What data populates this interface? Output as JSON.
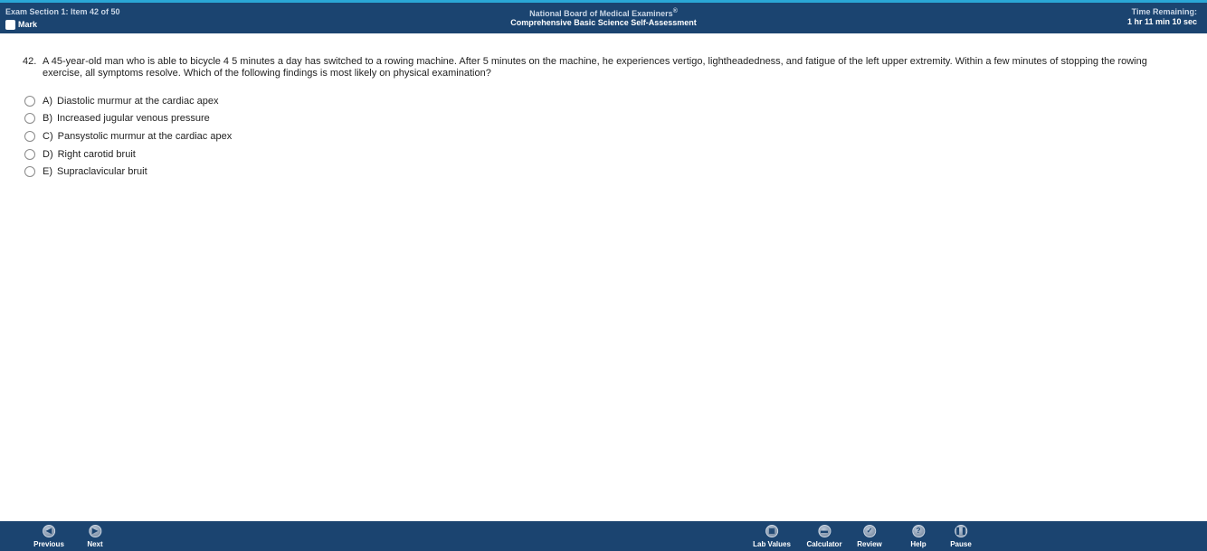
{
  "header": {
    "section_label": "Exam Section 1: Item 42 of 50",
    "mark_label": "Mark",
    "org_name": "National Board of Medical Examiners",
    "org_mark": "®",
    "assessment_name": "Comprehensive Basic Science Self-Assessment",
    "time_label": "Time Remaining:",
    "time_value": "1 hr 11 min 10 sec"
  },
  "question": {
    "number": "42.",
    "text": "A 45-year-old man who is able to bicycle 4 5 minutes a day has switched to a rowing machine. After 5 minutes on the machine, he experiences vertigo, lightheadedness, and fatigue of the left upper extremity. Within a few minutes of stopping the rowing exercise, all symptoms resolve. Which of the following findings is most likely on physical examination?"
  },
  "options": [
    {
      "letter": "A)",
      "text": "Diastolic murmur at the cardiac apex"
    },
    {
      "letter": "B)",
      "text": "Increased jugular venous pressure"
    },
    {
      "letter": "C)",
      "text": "Pansystolic murmur at the cardiac apex"
    },
    {
      "letter": "D)",
      "text": "Right carotid bruit"
    },
    {
      "letter": "E)",
      "text": "Supraclavicular bruit"
    }
  ],
  "footer": {
    "previous": {
      "label": "Previous",
      "icon": "arrow-left-icon",
      "glyph": "◀"
    },
    "next": {
      "label": "Next",
      "icon": "arrow-right-icon",
      "glyph": "▶"
    },
    "lab_values": {
      "label": "Lab Values",
      "icon": "lab-values-icon",
      "glyph": "▦"
    },
    "calculator": {
      "label": "Calculator",
      "icon": "calculator-icon",
      "glyph": "▬"
    },
    "review": {
      "label": "Review",
      "icon": "review-check-icon",
      "glyph": "✓"
    },
    "help": {
      "label": "Help",
      "icon": "help-icon",
      "glyph": "?"
    },
    "pause": {
      "label": "Pause",
      "icon": "pause-icon",
      "glyph": "❚❚"
    }
  },
  "colors": {
    "bar_background": "#1b4470",
    "accent_stripe": "#2aa7d6"
  }
}
